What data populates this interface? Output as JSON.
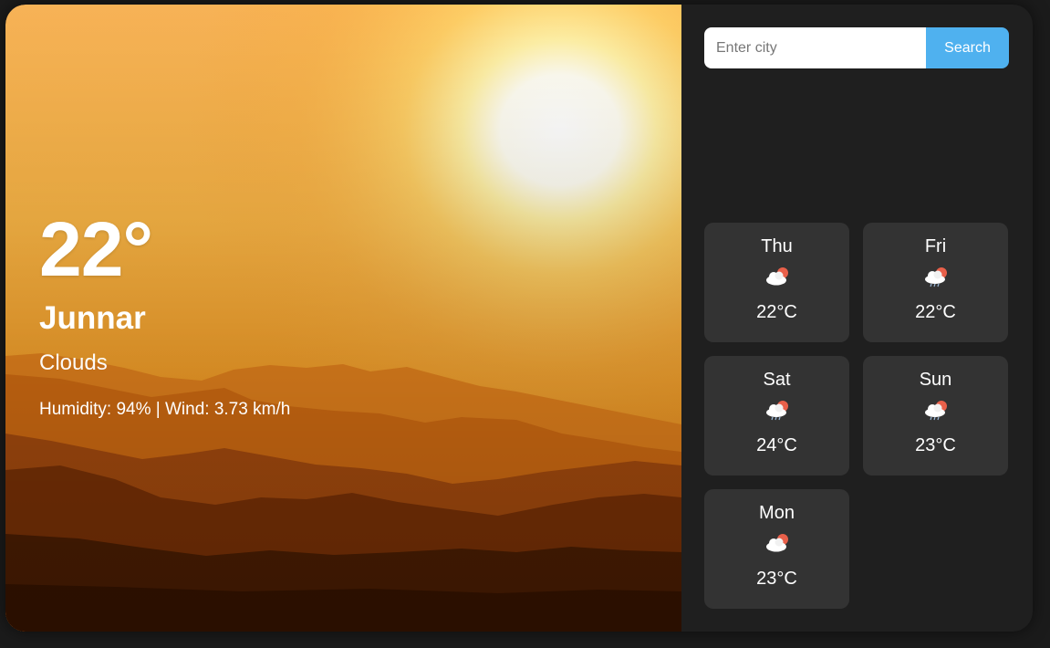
{
  "current": {
    "temperature": "22°",
    "city": "Junnar",
    "condition": "Clouds",
    "details": "Humidity: 94% | Wind: 3.73 km/h"
  },
  "search": {
    "placeholder": "Enter city",
    "value": "",
    "button_label": "Search"
  },
  "forecast": [
    {
      "day": "Thu",
      "temp": "22°C",
      "icon": "cloud-sun-icon"
    },
    {
      "day": "Fri",
      "temp": "22°C",
      "icon": "cloud-sun-rain-icon"
    },
    {
      "day": "Sat",
      "temp": "24°C",
      "icon": "cloud-sun-rain-icon"
    },
    {
      "day": "Sun",
      "temp": "23°C",
      "icon": "cloud-sun-rain-icon"
    },
    {
      "day": "Mon",
      "temp": "23°C",
      "icon": "cloud-sun-icon"
    }
  ],
  "colors": {
    "accent": "#4fb1ef",
    "card": "#333333",
    "panel": "#1f1f1f",
    "sun_badge": "#e9604a"
  }
}
